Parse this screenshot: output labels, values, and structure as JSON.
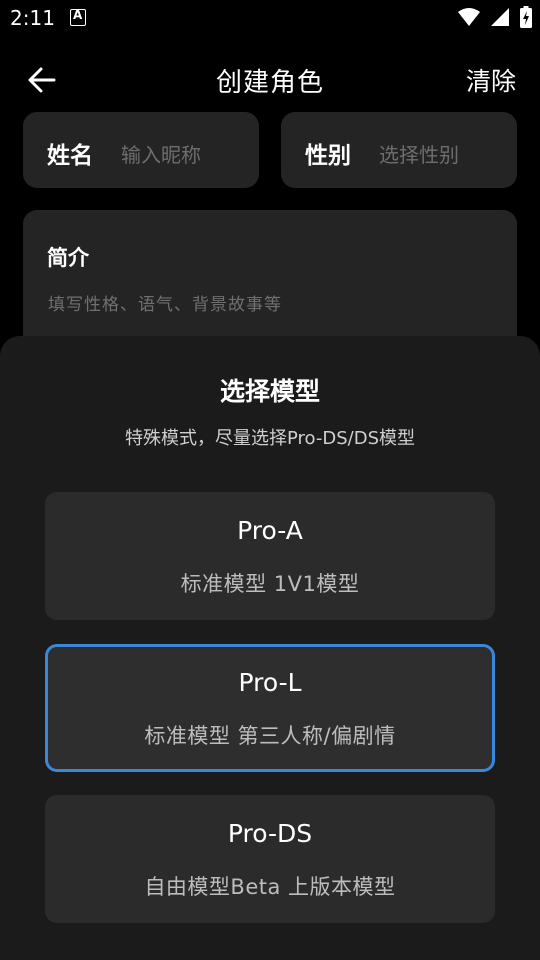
{
  "status_bar": {
    "time": "2:11"
  },
  "header": {
    "title": "创建角色",
    "clear_label": "清除"
  },
  "form": {
    "name_label": "姓名",
    "name_placeholder": "输入昵称",
    "gender_label": "性别",
    "gender_placeholder": "选择性别",
    "intro_label": "简介",
    "intro_placeholder": "填写性格、语气、背景故事等"
  },
  "model_sheet": {
    "title": "选择模型",
    "subtitle": "特殊模式，尽量选择Pro-DS/DS模型",
    "models": [
      {
        "name": "Pro-A",
        "description": "标准模型 1V1模型",
        "selected": false
      },
      {
        "name": "Pro-L",
        "description": "标准模型 第三人称/偏剧情",
        "selected": true
      },
      {
        "name": "Pro-DS",
        "description": "自由模型Beta 上版本模型",
        "selected": false
      }
    ],
    "selected_border_color": "#3a86d8"
  },
  "icons": {
    "back": "arrow-left-icon",
    "notification": "app-notification-icon",
    "wifi": "wifi-icon",
    "signal": "cell-signal-icon",
    "battery": "battery-charging-icon"
  }
}
